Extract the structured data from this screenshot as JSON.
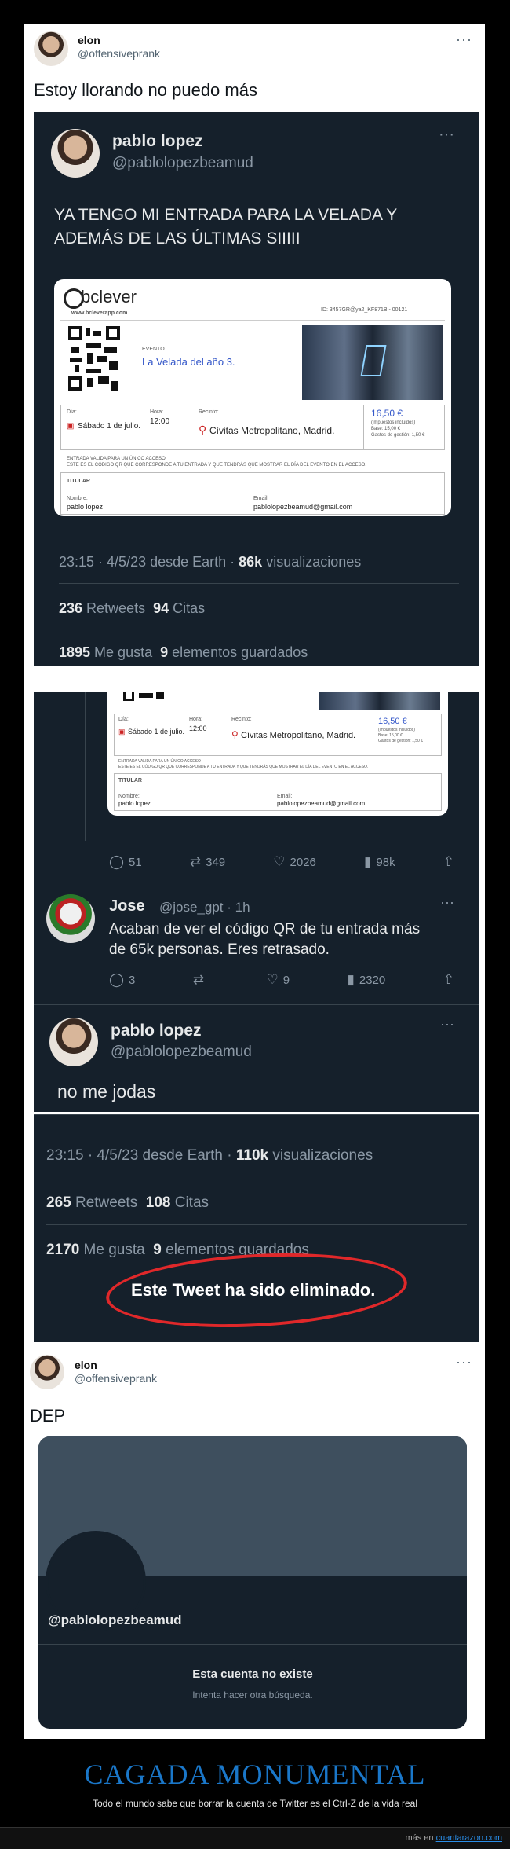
{
  "tweet1": {
    "name": "elon",
    "handle": "@offensiveprank",
    "text": "Estoy llorando no puedo más",
    "more": "···"
  },
  "quoted": {
    "name": "pablo lopez",
    "handle": "@pablolopezbeamud",
    "more": "···",
    "text_line1": "YA TENGO MI ENTRADA PARA LA VELADA Y",
    "text_line2": "ADEMÁS DE LAS ÚLTIMAS SIIIII",
    "meta": "23:15 · 4/5/23 desde Earth · ",
    "views_num": "86k",
    "views_label": " visualizaciones",
    "retweets_num": "236",
    "retweets_label": " Retweets",
    "quotes_num": "94",
    "quotes_label": " Citas",
    "likes_num": "1895",
    "likes_label": " Me gusta",
    "saved_num": "9",
    "saved_label": " elementos guardados"
  },
  "ticket": {
    "brand": "bclever",
    "site": "www.bcleverapp.com",
    "id": "ID: 3457GR@ya2_KF871B - 00121",
    "event_label": "EVENTO",
    "event": "La Velada del año 3.",
    "day_label": "Día:",
    "day": "Sábado 1 de julio.",
    "hour_label": "Hora:",
    "hour": "12:00",
    "venue_label": "Recinto:",
    "venue": "Cívitas Metropolitano, Madrid.",
    "price": "16,50 €",
    "price_note": "(impuestos incluidos)",
    "price_base": "Base: 15,00 €",
    "price_fee": "Gastos de gestión: 1,50 €",
    "notice1": "ENTRADA VALIDA PARA UN ÚNICO ACCESO",
    "notice2": "ESTE ES EL CÓDIGO QR QUE CORRESPONDE A TU ENTRADA Y QUE TENDRÁS QUE MOSTRAR EL DÍA DEL EVENTO EN EL ACCESO.",
    "holder_label": "TITULAR",
    "name_label": "Nombre:",
    "name": "pablo lopez",
    "email_label": "Email:",
    "email": "pablolopezbeamud@gmail.com"
  },
  "thread": {
    "actions": {
      "replies": "51",
      "retweets": "349",
      "likes": "2026",
      "views": "98k"
    },
    "reply": {
      "name": "Jose",
      "handle": "@jose_gpt · 1h",
      "more": "···",
      "line1": "Acaban de ver el código QR de tu entrada más",
      "line2": "de 65k personas. Eres retrasado.",
      "actions": {
        "replies": "3",
        "retweets": "",
        "likes": "9",
        "views": "2320"
      }
    },
    "answer": {
      "name": "pablo lopez",
      "handle": "@pablolopezbeamud",
      "more": "···",
      "text": "no me jodas"
    }
  },
  "deleted": {
    "meta": "23:15 · 4/5/23 desde Earth · ",
    "views_num": "110k",
    "views_label": " visualizaciones",
    "retweets_num": "265",
    "retweets_label": " Retweets",
    "quotes_num": "108",
    "quotes_label": " Citas",
    "likes_num": "2170",
    "likes_label": " Me gusta",
    "saved_num": "9",
    "saved_label": " elementos guardados",
    "notice": "Este Tweet ha sido eliminado."
  },
  "tweet2": {
    "name": "elon",
    "handle": "@offensiveprank",
    "more": "···",
    "text": "DEP"
  },
  "profile": {
    "handle": "@pablolopezbeamud",
    "title": "Esta cuenta no existe",
    "subtitle": "Intenta hacer otra búsqueda."
  },
  "footer": {
    "title": "CAGADA MONUMENTAL",
    "subtitle": "Todo el mundo sabe que borrar la cuenta de Twitter es el Ctrl-Z de la vida real",
    "credit_prefix": "más en ",
    "credit_link": "cuantarazon.com"
  },
  "colors": {
    "twitter_dark": "#15202b",
    "accent_title": "#1a77c9",
    "circle": "#e0282a"
  }
}
